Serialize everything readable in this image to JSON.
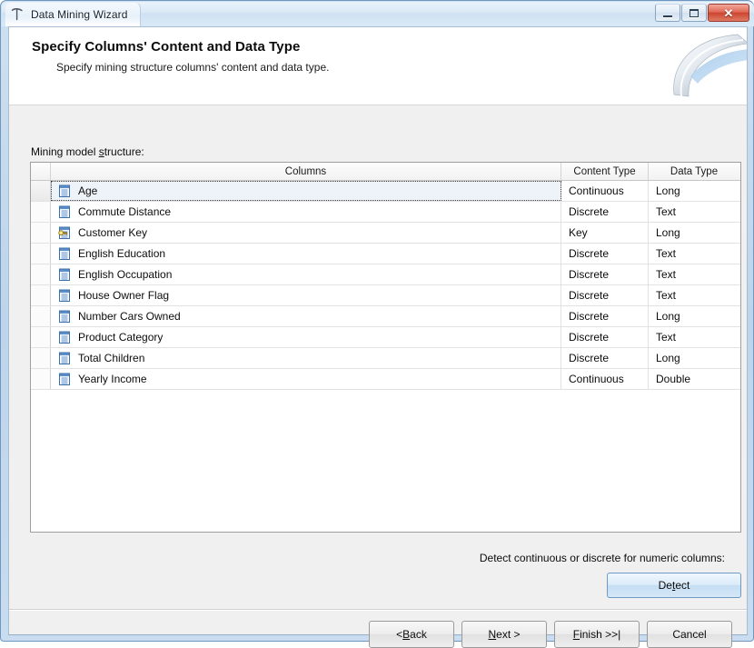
{
  "window": {
    "title": "Data Mining Wizard",
    "icon": "pickaxe-icon",
    "controls": {
      "minimize": "minimize-icon",
      "maximize": "maximize-icon",
      "close": "✕"
    }
  },
  "banner": {
    "title": "Specify Columns' Content and Data Type",
    "subtitle": "Specify mining structure columns' content and data type."
  },
  "section": {
    "label_before": "Mining model ",
    "label_accesskey": "s",
    "label_after": "tructure:"
  },
  "grid": {
    "headers": {
      "selector": "",
      "columns": "Columns",
      "content_type": "Content Type",
      "data_type": "Data Type"
    },
    "rows": [
      {
        "icon": "table-column-icon",
        "name": "Age",
        "content_type": "Continuous",
        "data_type": "Long",
        "selected": true
      },
      {
        "icon": "table-column-icon",
        "name": "Commute Distance",
        "content_type": "Discrete",
        "data_type": "Text",
        "selected": false
      },
      {
        "icon": "table-key-column-icon",
        "name": "Customer Key",
        "content_type": "Key",
        "data_type": "Long",
        "selected": false
      },
      {
        "icon": "table-column-icon",
        "name": "English Education",
        "content_type": "Discrete",
        "data_type": "Text",
        "selected": false
      },
      {
        "icon": "table-column-icon",
        "name": "English Occupation",
        "content_type": "Discrete",
        "data_type": "Text",
        "selected": false
      },
      {
        "icon": "table-column-icon",
        "name": "House Owner Flag",
        "content_type": "Discrete",
        "data_type": "Text",
        "selected": false
      },
      {
        "icon": "table-column-icon",
        "name": "Number Cars Owned",
        "content_type": "Discrete",
        "data_type": "Long",
        "selected": false
      },
      {
        "icon": "table-column-icon",
        "name": "Product Category",
        "content_type": "Discrete",
        "data_type": "Text",
        "selected": false
      },
      {
        "icon": "table-column-icon",
        "name": "Total Children",
        "content_type": "Discrete",
        "data_type": "Long",
        "selected": false
      },
      {
        "icon": "table-column-icon",
        "name": "Yearly Income",
        "content_type": "Continuous",
        "data_type": "Double",
        "selected": false
      }
    ]
  },
  "detect": {
    "label": "Detect continuous or discrete for numeric columns:",
    "button_before": "De",
    "button_accesskey": "t",
    "button_after": "ect"
  },
  "nav": {
    "back_before": "< ",
    "back_accesskey": "B",
    "back_after": "ack",
    "next_accesskey": "N",
    "next_after": "ext >",
    "finish_accesskey": "F",
    "finish_after": "inish >>|",
    "cancel": "Cancel"
  },
  "colors": {
    "window_border": "#6f96bf",
    "accent_blue": "#2a6099",
    "close_red": "#cc4631",
    "selection": "#eef3f9",
    "key_gold": "#e8c840"
  }
}
